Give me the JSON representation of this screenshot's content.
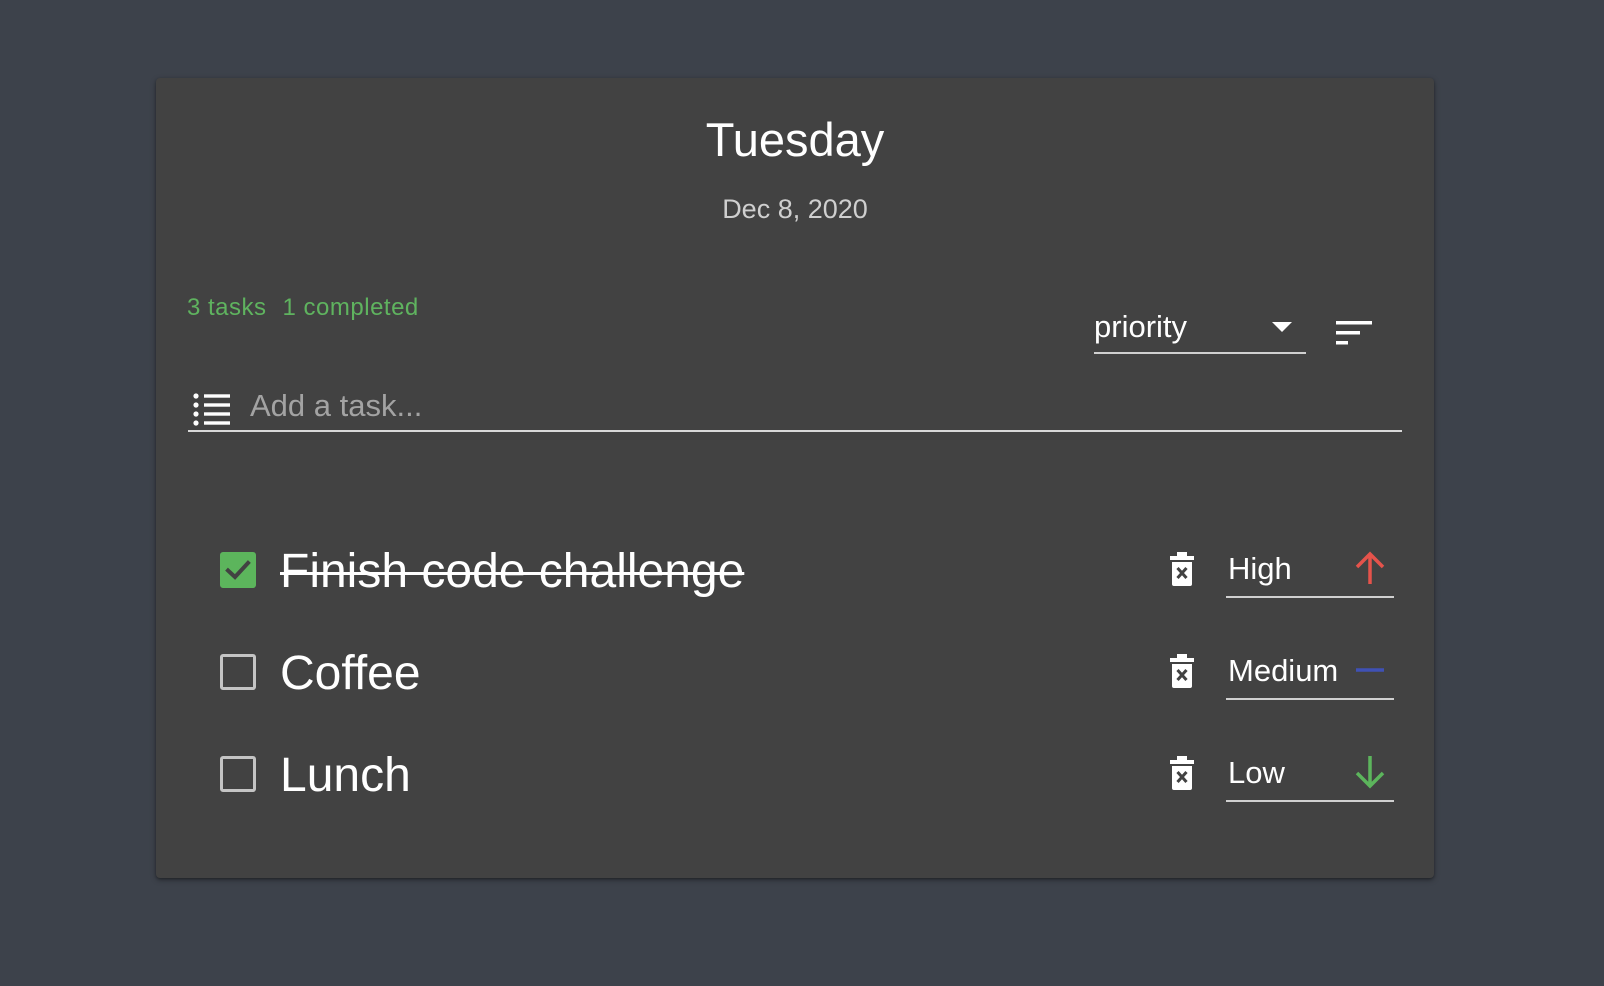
{
  "header": {
    "day": "Tuesday",
    "date": "Dec 8, 2020"
  },
  "stats": {
    "tasks": "3 tasks",
    "completed": "1 completed"
  },
  "sort": {
    "value": "priority",
    "direction_icon": "sort-icon"
  },
  "add_task": {
    "placeholder": "Add a task...",
    "value": "",
    "icon": "list-icon"
  },
  "tasks": [
    {
      "label": "Finish code challenge",
      "completed": true,
      "priority": "High",
      "priority_icon": "arrow-up-icon",
      "priority_color": "#e5534b"
    },
    {
      "label": "Coffee",
      "completed": false,
      "priority": "Medium",
      "priority_icon": "minus-icon",
      "priority_color": "#3f51b5"
    },
    {
      "label": "Lunch",
      "completed": false,
      "priority": "Low",
      "priority_icon": "arrow-down-icon",
      "priority_color": "#5cb55c"
    }
  ],
  "colors": {
    "background": "#3d424b",
    "card": "#424242",
    "accent_green": "#5cb55c",
    "stats_text": "#5fb35f"
  }
}
